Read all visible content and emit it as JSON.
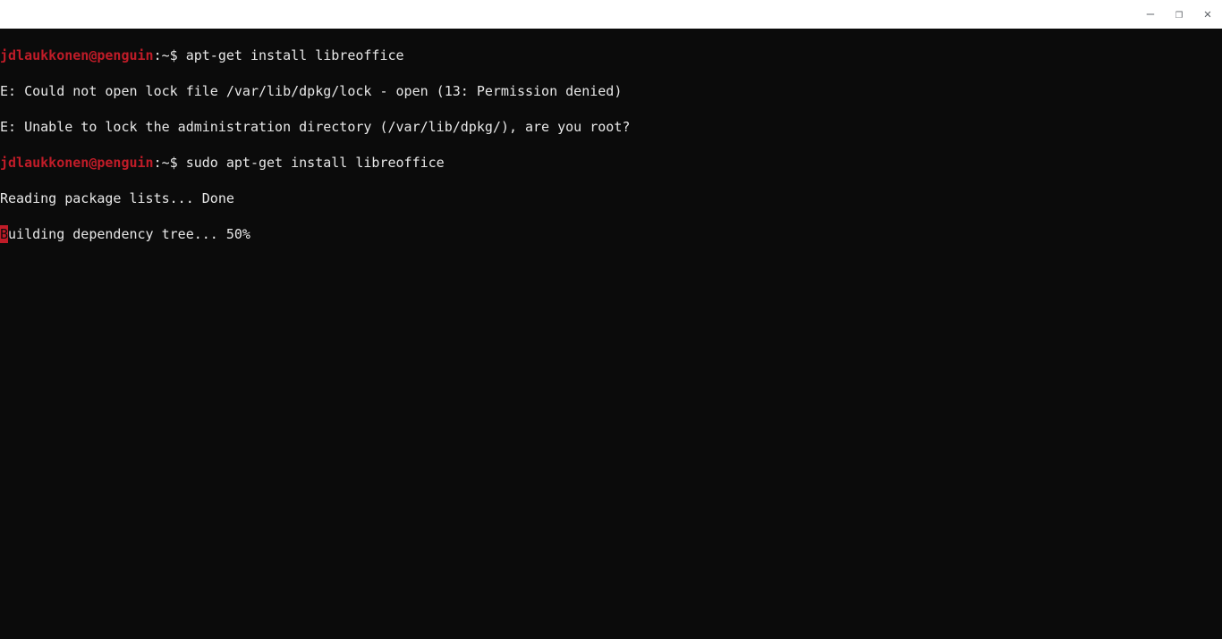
{
  "titlebar": {
    "minimize_glyph": "—",
    "maximize_glyph": "❐",
    "close_glyph": "✕"
  },
  "terminal": {
    "prompt_user": "jdlaukkonen@penguin",
    "prompt_path": ":~$ ",
    "lines": {
      "l0_cmd": "apt-get install libreoffice",
      "l1": "E: Could not open lock file /var/lib/dpkg/lock - open (13: Permission denied)",
      "l2": "E: Unable to lock the administration directory (/var/lib/dpkg/), are you root?",
      "l3_cmd": "sudo apt-get install libreoffice",
      "l4": "Reading package lists... Done",
      "l5_cursor_char": "B",
      "l5_rest": "uilding dependency tree... 50%"
    }
  }
}
